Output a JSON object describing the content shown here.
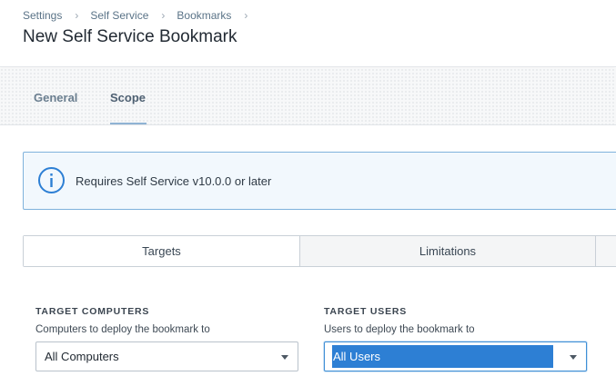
{
  "breadcrumb": [
    "Settings",
    "Self Service",
    "Bookmarks"
  ],
  "page_title": "New Self Service Bookmark",
  "tabs": [
    {
      "label": "General",
      "active": false
    },
    {
      "label": "Scope",
      "active": true
    }
  ],
  "info": {
    "icon": "info-icon",
    "text": "Requires Self Service v10.0.0 or later"
  },
  "subtabs": [
    {
      "label": "Targets",
      "selected": true
    },
    {
      "label": "Limitations",
      "selected": false
    }
  ],
  "target_computers": {
    "title": "TARGET COMPUTERS",
    "description": "Computers to deploy the bookmark to",
    "value": "All Computers"
  },
  "target_users": {
    "title": "TARGET USERS",
    "description": "Users to deploy the bookmark to",
    "value": "All Users"
  },
  "colors": {
    "accent": "#2d7fd4",
    "info_border": "#7fb2dc",
    "info_bg": "#f2f8fd"
  }
}
